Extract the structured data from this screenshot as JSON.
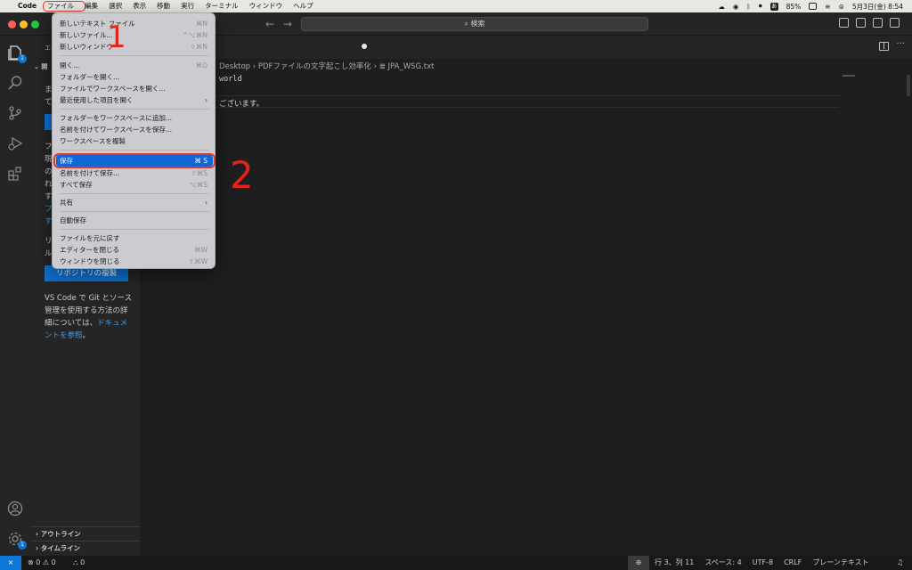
{
  "menubar": {
    "apple": "",
    "app": "Code",
    "items": [
      "ファイル",
      "編集",
      "選択",
      "表示",
      "移動",
      "実行",
      "ターミナル",
      "ウィンドウ",
      "ヘルプ"
    ],
    "input_method": "あ",
    "battery": "85%",
    "clock": "5月3日(金)  8:54"
  },
  "titlebar": {
    "nav_back": "←",
    "nav_forward": "→",
    "search_placeholder": "⌕ 検索"
  },
  "activity_bar": {
    "explorer_badge": "1",
    "settings_badge": "1"
  },
  "sidebar": {
    "header": "エ",
    "section": "開",
    "fragments": [
      "ま",
      "て",
      "フ",
      "現",
      "の",
      "れ",
      "す",
      "フ",
      "す",
      "リ",
      "ル"
    ],
    "clone_button": "リポジトリの複製",
    "git_info_text": "VS Code で Git とソース管理を使用する方法の詳細については、",
    "git_info_link": "ドキュメントを参照",
    "git_info_end": "。",
    "outline": "アウトライン",
    "timeline": "タイムライン"
  },
  "editor": {
    "breadcrumb": "Desktop  ›  PDFファイルの文字起こし効率化  ›  ≣ JPA_WSG.txt",
    "line1": "world",
    "line3": "ございます。"
  },
  "file_menu": {
    "items": [
      {
        "label": "新しいテキスト ファイル",
        "shortcut": "⌘N"
      },
      {
        "label": "新しいファイル...",
        "shortcut": "^⌥⌘N"
      },
      {
        "label": "新しいウィンドウ",
        "shortcut": "⇧⌘N"
      },
      {
        "label": "開く...",
        "shortcut": "⌘O"
      },
      {
        "label": "フォルダーを開く...",
        "shortcut": ""
      },
      {
        "label": "ファイルでワークスペースを開く...",
        "shortcut": ""
      },
      {
        "label": "最近使用した項目を開く",
        "shortcut": "›"
      },
      {
        "label": "フォルダーをワークスペースに追加...",
        "shortcut": ""
      },
      {
        "label": "名前を付けてワークスペースを保存...",
        "shortcut": ""
      },
      {
        "label": "ワークスペースを複製",
        "shortcut": ""
      },
      {
        "label": "保存",
        "shortcut": "⌘ S"
      },
      {
        "label": "名前を付けて保存...",
        "shortcut": "⇧⌘S"
      },
      {
        "label": "すべて保存",
        "shortcut": "⌥⌘S"
      },
      {
        "label": "共有",
        "shortcut": "›"
      },
      {
        "label": "自動保存",
        "shortcut": ""
      },
      {
        "label": "ファイルを元に戻す",
        "shortcut": ""
      },
      {
        "label": "エディターを閉じる",
        "shortcut": "⌘W"
      },
      {
        "label": "ウィンドウを閉じる",
        "shortcut": "⇧⌘W"
      }
    ]
  },
  "annotations": {
    "step1": "1",
    "step2": "2"
  },
  "statusbar": {
    "remote": "⨯",
    "errors": "⊗ 0  ⚠ 0",
    "ports": "⛬ 0",
    "zoom": "⊕",
    "position": "行 3、列 11",
    "spaces": "スペース: 4",
    "encoding": "UTF-8",
    "eol": "CRLF",
    "language": "プレーンテキスト",
    "bell": "🔔"
  }
}
